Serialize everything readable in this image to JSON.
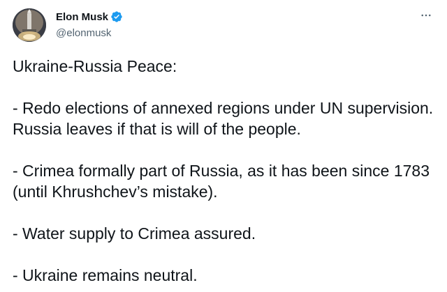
{
  "author": {
    "display_name": "Elon Musk",
    "handle": "@elonmusk",
    "verified": true,
    "verified_color": "#1d9bf0",
    "avatar_icon": "rocket-launch-avatar"
  },
  "menu": {
    "icon": "more-horizontal-icon"
  },
  "tweet": {
    "paragraphs": [
      "Ukraine-Russia Peace:",
      "- Redo elections of annexed regions under UN supervision. Russia leaves if that is will of the people.",
      "- Crimea formally part of Russia, as it has been since 1783 (until Khrushchev’s mistake).",
      "- Water supply to Crimea assured.",
      "- Ukraine remains neutral."
    ]
  }
}
